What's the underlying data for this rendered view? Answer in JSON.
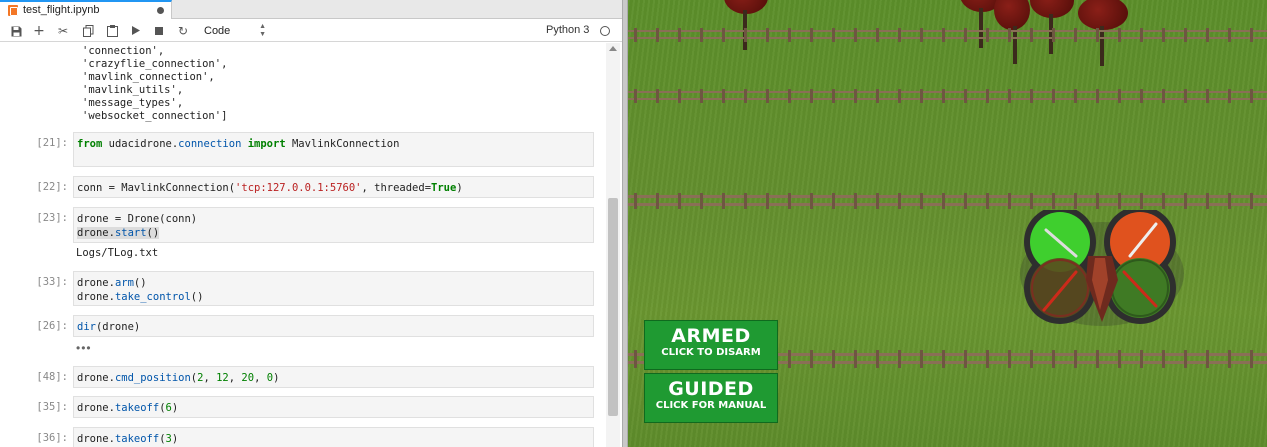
{
  "notebook": {
    "tab": {
      "title": "test_flight.ipynb"
    },
    "toolbar": {
      "cell_type": "Code",
      "kernel": "Python 3",
      "icons": [
        "save-icon",
        "add-cell-icon",
        "cut-icon",
        "copy-icon",
        "paste-icon",
        "run-icon",
        "stop-icon",
        "restart-icon"
      ]
    },
    "output_top": [
      "'connection',",
      "'crazyflie_connection',",
      "'mavlink_connection',",
      "'mavlink_utils',",
      "'message_types',",
      "'websocket_connection']"
    ],
    "cells": [
      {
        "prompt": "[21]:",
        "kw1": "from",
        "mod": "udacidrone.",
        "modattr": "connection",
        "kw2": "import",
        "name": "MavlinkConnection"
      },
      {
        "prompt": "[22]:",
        "pre": "conn = MavlinkConnection(",
        "str": "'tcp:127.0.0.1:5760'",
        "mid": ", threaded=",
        "kw": "True",
        "post": ")"
      },
      {
        "prompt": "[23]:",
        "line1": "drone = Drone(conn)",
        "line2_obj": "drone.",
        "line2_attr": "start",
        "line2_post": "()",
        "output": "Logs/TLog.txt"
      },
      {
        "prompt": "[33]:",
        "line1_obj": "drone.",
        "line1_attr": "arm",
        "line1_post": "()",
        "line2_obj": "drone.",
        "line2_attr": "take_control",
        "line2_post": "()"
      },
      {
        "prompt": "[26]:",
        "fn": "dir",
        "post": "(drone)",
        "collapsed_output": "•••"
      },
      {
        "prompt": "[48]:",
        "obj": "drone.",
        "attr": "cmd_position",
        "open": "(",
        "n1": "2",
        "sep1": ", ",
        "n2": "12",
        "sep2": ", ",
        "n3": "20",
        "sep3": ", ",
        "n4": "0",
        "close": ")"
      },
      {
        "prompt": "[35]:",
        "obj": "drone.",
        "attr": "takeoff",
        "open": "(",
        "n1": "6",
        "close": ")"
      },
      {
        "prompt": "[36]:",
        "obj": "drone.",
        "attr": "takeoff",
        "open": "(",
        "n1": "3",
        "close": ")"
      }
    ]
  },
  "simulator": {
    "armed_button": {
      "title": "ARMED",
      "subtitle": "CLICK TO DISARM"
    },
    "guided_button": {
      "title": "GUIDED",
      "subtitle": "CLICK FOR MANUAL"
    },
    "colors": {
      "button_green": "#1f9a32",
      "grass": "#5e8c2b",
      "fence": "#8a6f56",
      "rotor_front_left": "#3fcf2e",
      "rotor_front_right": "#e0521e"
    }
  }
}
